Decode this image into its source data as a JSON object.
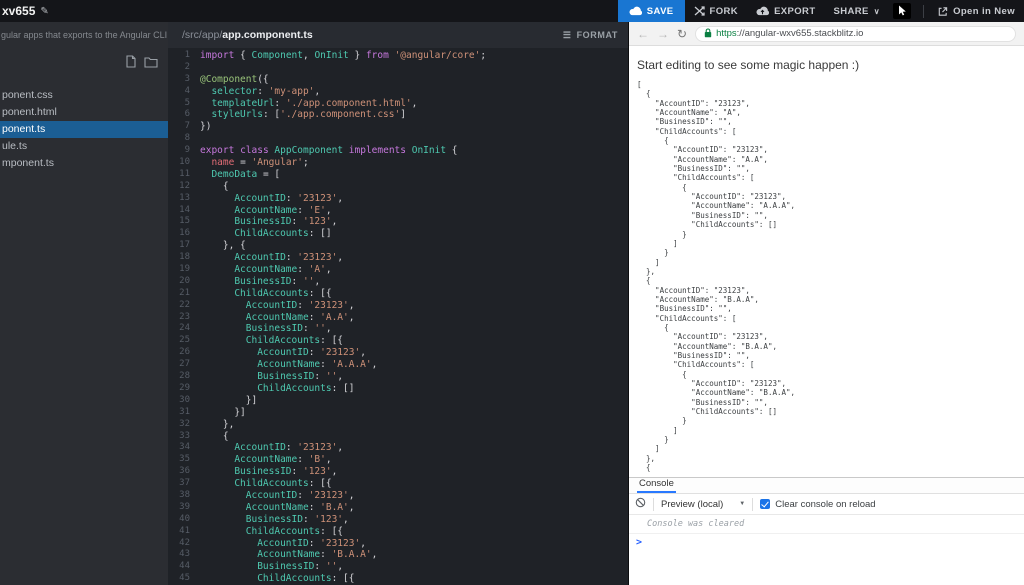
{
  "topbar": {
    "project_name": "xv655",
    "save_label": "SAVE",
    "fork_label": "FORK",
    "export_label": "EXPORT",
    "share_label": "SHARE",
    "open_in_new_label": "Open in New"
  },
  "icons": {
    "edit": "✎",
    "menu": "☰",
    "chevron_down": "∨",
    "caret_down": "▼",
    "back": "←",
    "forward": "→",
    "refresh": "↻"
  },
  "sidebar": {
    "description": "gular apps that exports to the Angular CLI",
    "files": [
      {
        "label": "ponent.css",
        "selected": false
      },
      {
        "label": "ponent.html",
        "selected": false
      },
      {
        "label": "ponent.ts",
        "selected": true
      },
      {
        "label": "ule.ts",
        "selected": false
      },
      {
        "label": "mponent.ts",
        "selected": false
      }
    ]
  },
  "editor": {
    "path_prefix": "/src/app/",
    "file_name": "app.component.ts",
    "format_label": "FORMAT",
    "lines": [
      [
        [
          "k",
          "import"
        ],
        [
          "p",
          " { "
        ],
        [
          "t",
          "Component"
        ],
        [
          "p",
          ", "
        ],
        [
          "t",
          "OnInit"
        ],
        [
          "p",
          " } "
        ],
        [
          "k",
          "from"
        ],
        [
          "p",
          " "
        ],
        [
          "s",
          "'@angular/core'"
        ],
        [
          "p",
          ";"
        ]
      ],
      [],
      [
        [
          "d",
          "@Component"
        ],
        [
          "p",
          "({"
        ]
      ],
      [
        [
          "p",
          "  "
        ],
        [
          "t",
          "selector"
        ],
        [
          "p",
          ": "
        ],
        [
          "s",
          "'my-app'"
        ],
        [
          "p",
          ","
        ]
      ],
      [
        [
          "p",
          "  "
        ],
        [
          "t",
          "templateUrl"
        ],
        [
          "p",
          ": "
        ],
        [
          "s",
          "'./app.component.html'"
        ],
        [
          "p",
          ","
        ]
      ],
      [
        [
          "p",
          "  "
        ],
        [
          "t",
          "styleUrls"
        ],
        [
          "p",
          ": ["
        ],
        [
          "s",
          "'./app.component.css'"
        ],
        [
          "p",
          "]"
        ]
      ],
      [
        [
          "p",
          "})"
        ]
      ],
      [],
      [
        [
          "k",
          "export"
        ],
        [
          "p",
          " "
        ],
        [
          "k",
          "class"
        ],
        [
          "p",
          " "
        ],
        [
          "t",
          "AppComponent"
        ],
        [
          "p",
          " "
        ],
        [
          "k",
          "implements"
        ],
        [
          "p",
          " "
        ],
        [
          "t",
          "OnInit"
        ],
        [
          "p",
          " {"
        ]
      ],
      [
        [
          "p",
          "  "
        ],
        [
          "v",
          "name"
        ],
        [
          "p",
          " = "
        ],
        [
          "s",
          "'Angular'"
        ],
        [
          "p",
          ";"
        ]
      ],
      [
        [
          "p",
          "  "
        ],
        [
          "t",
          "DemoData"
        ],
        [
          "p",
          " = ["
        ]
      ],
      [
        [
          "p",
          "    {"
        ]
      ],
      [
        [
          "p",
          "      "
        ],
        [
          "t",
          "AccountID"
        ],
        [
          "p",
          ": "
        ],
        [
          "s",
          "'23123'"
        ],
        [
          "p",
          ","
        ]
      ],
      [
        [
          "p",
          "      "
        ],
        [
          "t",
          "AccountName"
        ],
        [
          "p",
          ": "
        ],
        [
          "s",
          "'E'"
        ],
        [
          "p",
          ","
        ]
      ],
      [
        [
          "p",
          "      "
        ],
        [
          "t",
          "BusinessID"
        ],
        [
          "p",
          ": "
        ],
        [
          "s",
          "'123'"
        ],
        [
          "p",
          ","
        ]
      ],
      [
        [
          "p",
          "      "
        ],
        [
          "t",
          "ChildAccounts"
        ],
        [
          "p",
          ": []"
        ]
      ],
      [
        [
          "p",
          "    }, {"
        ]
      ],
      [
        [
          "p",
          "      "
        ],
        [
          "t",
          "AccountID"
        ],
        [
          "p",
          ": "
        ],
        [
          "s",
          "'23123'"
        ],
        [
          "p",
          ","
        ]
      ],
      [
        [
          "p",
          "      "
        ],
        [
          "t",
          "AccountName"
        ],
        [
          "p",
          ": "
        ],
        [
          "s",
          "'A'"
        ],
        [
          "p",
          ","
        ]
      ],
      [
        [
          "p",
          "      "
        ],
        [
          "t",
          "BusinessID"
        ],
        [
          "p",
          ": "
        ],
        [
          "s",
          "''"
        ],
        [
          "p",
          ","
        ]
      ],
      [
        [
          "p",
          "      "
        ],
        [
          "t",
          "ChildAccounts"
        ],
        [
          "p",
          ": [{"
        ]
      ],
      [
        [
          "p",
          "        "
        ],
        [
          "t",
          "AccountID"
        ],
        [
          "p",
          ": "
        ],
        [
          "s",
          "'23123'"
        ],
        [
          "p",
          ","
        ]
      ],
      [
        [
          "p",
          "        "
        ],
        [
          "t",
          "AccountName"
        ],
        [
          "p",
          ": "
        ],
        [
          "s",
          "'A.A'"
        ],
        [
          "p",
          ","
        ]
      ],
      [
        [
          "p",
          "        "
        ],
        [
          "t",
          "BusinessID"
        ],
        [
          "p",
          ": "
        ],
        [
          "s",
          "''"
        ],
        [
          "p",
          ","
        ]
      ],
      [
        [
          "p",
          "        "
        ],
        [
          "t",
          "ChildAccounts"
        ],
        [
          "p",
          ": [{"
        ]
      ],
      [
        [
          "p",
          "          "
        ],
        [
          "t",
          "AccountID"
        ],
        [
          "p",
          ": "
        ],
        [
          "s",
          "'23123'"
        ],
        [
          "p",
          ","
        ]
      ],
      [
        [
          "p",
          "          "
        ],
        [
          "t",
          "AccountName"
        ],
        [
          "p",
          ": "
        ],
        [
          "s",
          "'A.A.A'"
        ],
        [
          "p",
          ","
        ]
      ],
      [
        [
          "p",
          "          "
        ],
        [
          "t",
          "BusinessID"
        ],
        [
          "p",
          ": "
        ],
        [
          "s",
          "''"
        ],
        [
          "p",
          ","
        ]
      ],
      [
        [
          "p",
          "          "
        ],
        [
          "t",
          "ChildAccounts"
        ],
        [
          "p",
          ": []"
        ]
      ],
      [
        [
          "p",
          "        }]"
        ]
      ],
      [
        [
          "p",
          "      }]"
        ]
      ],
      [
        [
          "p",
          "    },"
        ]
      ],
      [
        [
          "p",
          "    {"
        ]
      ],
      [
        [
          "p",
          "      "
        ],
        [
          "t",
          "AccountID"
        ],
        [
          "p",
          ": "
        ],
        [
          "s",
          "'23123'"
        ],
        [
          "p",
          ","
        ]
      ],
      [
        [
          "p",
          "      "
        ],
        [
          "t",
          "AccountName"
        ],
        [
          "p",
          ": "
        ],
        [
          "s",
          "'B'"
        ],
        [
          "p",
          ","
        ]
      ],
      [
        [
          "p",
          "      "
        ],
        [
          "t",
          "BusinessID"
        ],
        [
          "p",
          ": "
        ],
        [
          "s",
          "'123'"
        ],
        [
          "p",
          ","
        ]
      ],
      [
        [
          "p",
          "      "
        ],
        [
          "t",
          "ChildAccounts"
        ],
        [
          "p",
          ": [{"
        ]
      ],
      [
        [
          "p",
          "        "
        ],
        [
          "t",
          "AccountID"
        ],
        [
          "p",
          ": "
        ],
        [
          "s",
          "'23123'"
        ],
        [
          "p",
          ","
        ]
      ],
      [
        [
          "p",
          "        "
        ],
        [
          "t",
          "AccountName"
        ],
        [
          "p",
          ": "
        ],
        [
          "s",
          "'B.A'"
        ],
        [
          "p",
          ","
        ]
      ],
      [
        [
          "p",
          "        "
        ],
        [
          "t",
          "BusinessID"
        ],
        [
          "p",
          ": "
        ],
        [
          "s",
          "'123'"
        ],
        [
          "p",
          ","
        ]
      ],
      [
        [
          "p",
          "        "
        ],
        [
          "t",
          "ChildAccounts"
        ],
        [
          "p",
          ": [{"
        ]
      ],
      [
        [
          "p",
          "          "
        ],
        [
          "t",
          "AccountID"
        ],
        [
          "p",
          ": "
        ],
        [
          "s",
          "'23123'"
        ],
        [
          "p",
          ","
        ]
      ],
      [
        [
          "p",
          "          "
        ],
        [
          "t",
          "AccountName"
        ],
        [
          "p",
          ": "
        ],
        [
          "s",
          "'B.A.A'"
        ],
        [
          "p",
          ","
        ]
      ],
      [
        [
          "p",
          "          "
        ],
        [
          "t",
          "BusinessID"
        ],
        [
          "p",
          ": "
        ],
        [
          "s",
          "''"
        ],
        [
          "p",
          ","
        ]
      ],
      [
        [
          "p",
          "          "
        ],
        [
          "t",
          "ChildAccounts"
        ],
        [
          "p",
          ": [{"
        ]
      ]
    ]
  },
  "preview": {
    "url_scheme": "https",
    "url_rest": "://angular-wxv655.stackblitz.io",
    "heading": "Start editing to see some magic happen :)",
    "json_lines": [
      "[",
      "  {",
      "    \"AccountID\": \"23123\",",
      "    \"AccountName\": \"A\",",
      "    \"BusinessID\": \"\",",
      "    \"ChildAccounts\": [",
      "      {",
      "        \"AccountID\": \"23123\",",
      "        \"AccountName\": \"A.A\",",
      "        \"BusinessID\": \"\",",
      "        \"ChildAccounts\": [",
      "          {",
      "            \"AccountID\": \"23123\",",
      "            \"AccountName\": \"A.A.A\",",
      "            \"BusinessID\": \"\",",
      "            \"ChildAccounts\": []",
      "          }",
      "        ]",
      "      }",
      "    ]",
      "  },",
      "  {",
      "    \"AccountID\": \"23123\",",
      "    \"AccountName\": \"B.A.A\",",
      "    \"BusinessID\": \"\",",
      "    \"ChildAccounts\": [",
      "      {",
      "        \"AccountID\": \"23123\",",
      "        \"AccountName\": \"B.A.A\",",
      "        \"BusinessID\": \"\",",
      "        \"ChildAccounts\": [",
      "          {",
      "            \"AccountID\": \"23123\",",
      "            \"AccountName\": \"B.A.A\",",
      "            \"BusinessID\": \"\",",
      "            \"ChildAccounts\": []",
      "          }",
      "        ]",
      "      }",
      "    ]",
      "  },",
      "  {"
    ]
  },
  "console_panel": {
    "tab_label": "Console",
    "target_label": "Preview (local)",
    "clear_checkbox_label": "Clear console on reload",
    "message": "Console was cleared",
    "prompt": ">"
  },
  "colors": {
    "save_button": "#1976d2",
    "selected_file_bg": "#1b5e94",
    "console_tab_accent": "#2979ff",
    "console_prompt": "#2962ff",
    "url_lock_green": "#0b8043",
    "keyword": "#c678dd",
    "type": "#4ec9b0",
    "string": "#ce9178"
  }
}
